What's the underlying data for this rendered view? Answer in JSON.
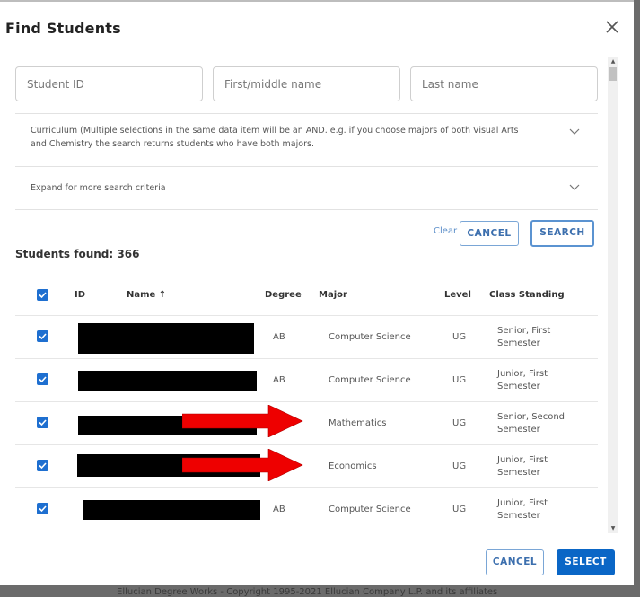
{
  "dialog": {
    "title": "Find Students",
    "close_icon": "close-icon"
  },
  "search": {
    "student_id_placeholder": "Student ID",
    "first_name_placeholder": "First/middle name",
    "last_name_placeholder": "Last name",
    "student_id_value": "",
    "first_name_value": "",
    "last_name_value": ""
  },
  "accordions": [
    {
      "label_line1": "Curriculum (Multiple selections in the same data item will be an AND. e.g. if you choose majors of both Visual Arts",
      "label_line2": "and Chemistry the search returns students who have both majors.",
      "icon": "chevron-down-icon"
    },
    {
      "label_line1": "Expand for more search criteria",
      "icon": "chevron-down-icon"
    }
  ],
  "search_actions": {
    "clear_label": "Clear",
    "cancel_label": "CANCEL",
    "search_label": "SEARCH"
  },
  "results": {
    "found_label": "Students found: 366",
    "count": 366
  },
  "table": {
    "columns": {
      "id": "ID",
      "name": "Name ↑",
      "degree": "Degree",
      "major": "Major",
      "level": "Level",
      "class_standing": "Class Standing"
    },
    "select_all_checked": true,
    "rows": [
      {
        "checked": true,
        "id": "[redacted]",
        "name": "[redacted]",
        "degree": "AB",
        "major": "Computer Science",
        "level": "UG",
        "standing_line1": "Senior, First",
        "standing_line2": "Semester"
      },
      {
        "checked": true,
        "id": "[redacted]",
        "name": "[redacted]",
        "degree": "AB",
        "major": "Computer Science",
        "level": "UG",
        "standing_line1": "Junior, First",
        "standing_line2": "Semester"
      },
      {
        "checked": true,
        "id": "[redacted]",
        "name": "[redacted]",
        "degree": "",
        "major": "Mathematics",
        "level": "UG",
        "standing_line1": "Senior, Second",
        "standing_line2": "Semester",
        "annotation": "red-arrow"
      },
      {
        "checked": true,
        "id": "[redacted]",
        "name": "[redacted]",
        "degree": "",
        "major": "Economics",
        "level": "UG",
        "standing_line1": "Junior, First",
        "standing_line2": "Semester",
        "annotation": "red-arrow"
      },
      {
        "checked": true,
        "id": "[redacted]",
        "name": "[redacted]",
        "degree": "AB",
        "major": "Computer Science",
        "level": "UG",
        "standing_line1": "Junior, First",
        "standing_line2": "Semester"
      }
    ]
  },
  "footer_actions": {
    "cancel_label": "CANCEL",
    "select_label": "SELECT"
  },
  "background": {
    "footer_text": "Ellucian Degree Works - Copyright 1995-2021 Ellucian Company L.P. and its affiliates"
  },
  "colors": {
    "primary": "#0a66c6",
    "checkbox": "#1e6fd0",
    "annotation_arrow": "#ee0000",
    "redaction": "#000000"
  }
}
